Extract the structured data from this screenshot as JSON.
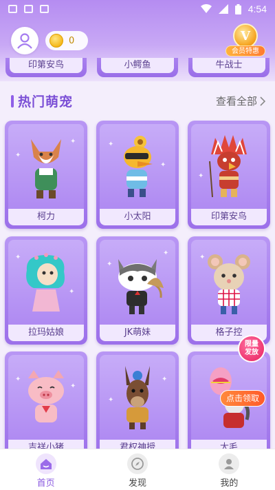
{
  "status_bar": {
    "time": "4:54"
  },
  "header": {
    "coin_count": "0",
    "vip_label": "会员特惠",
    "vip_mark": "V"
  },
  "partial_row": [
    "印第安鸟",
    "小鳄鱼",
    "牛战士"
  ],
  "section": {
    "title": "热门萌宠",
    "view_all": "查看全部"
  },
  "pets": [
    {
      "name": "柯力"
    },
    {
      "name": "小太阳"
    },
    {
      "name": "印第安鸟"
    },
    {
      "name": "拉玛姑娘"
    },
    {
      "name": "JK萌妹"
    },
    {
      "name": "格子控"
    },
    {
      "name": "吉祥小猪"
    },
    {
      "name": "君权神授"
    },
    {
      "name": "大毛"
    }
  ],
  "badges": {
    "limited_line1": "限量",
    "limited_line2": "发放",
    "claim": "点击领取"
  },
  "tabs": [
    {
      "label": "首页",
      "icon": "home-icon",
      "active": true
    },
    {
      "label": "发现",
      "icon": "compass-icon",
      "active": false
    },
    {
      "label": "我的",
      "icon": "profile-icon",
      "active": false
    }
  ],
  "colors": {
    "accent": "#8a5ae0",
    "card": "#a57cf0",
    "label_bg": "#f1e8fe"
  }
}
